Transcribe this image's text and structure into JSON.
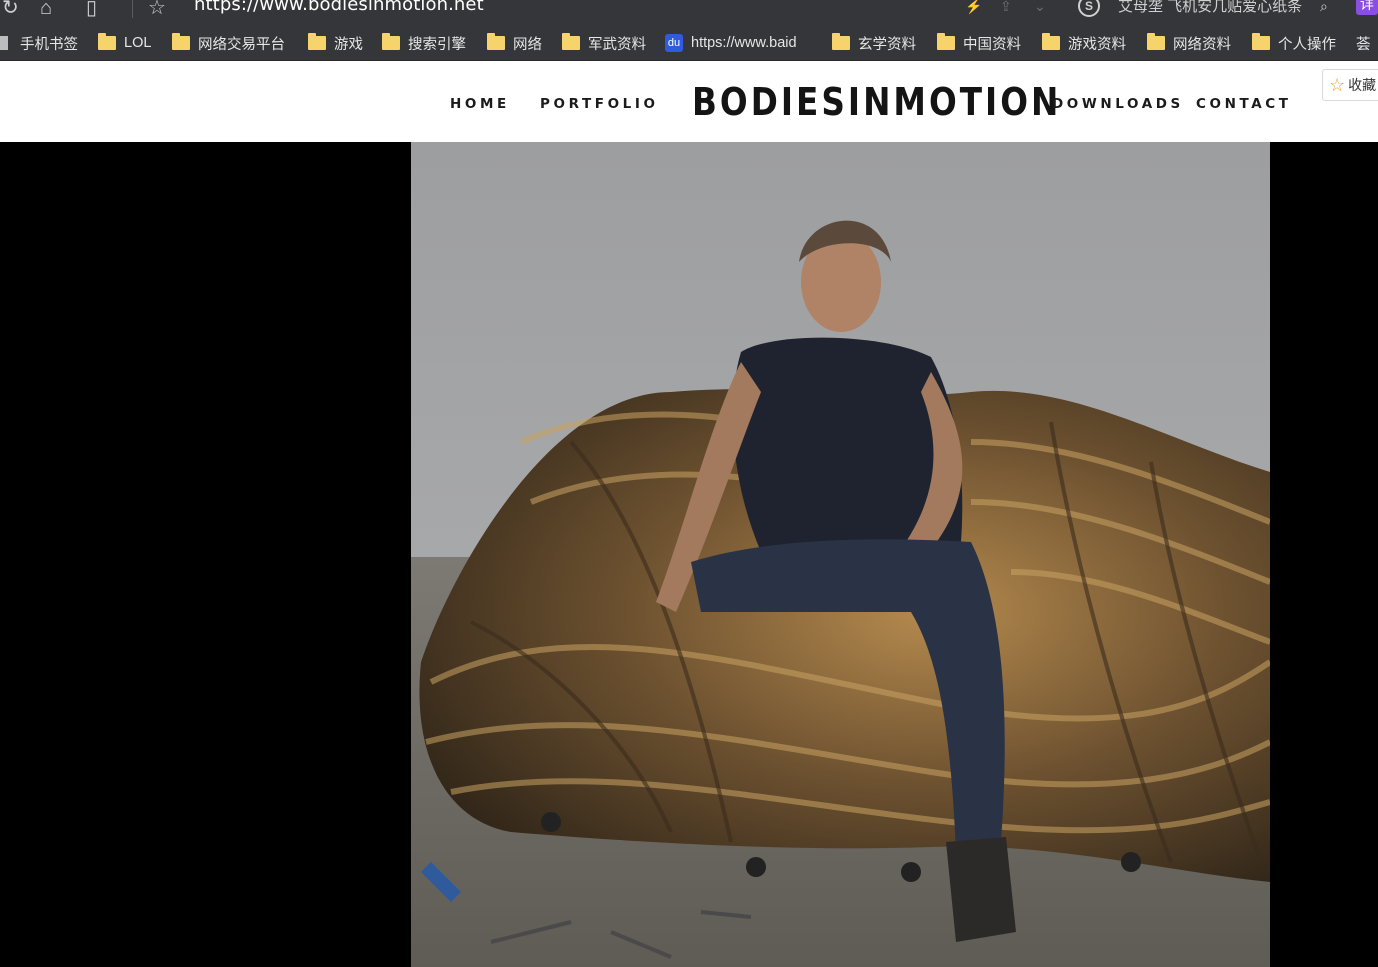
{
  "browser": {
    "url": "https://www.bodiesinmotion.net",
    "search_text": "艾母垄 飞机安几贴爱心纸条",
    "extension_label": "详"
  },
  "bookmarks": [
    {
      "label": "手机书签",
      "icon": "device-icon"
    },
    {
      "label": "LOL",
      "icon": "folder-icon"
    },
    {
      "label": "网络交易平台",
      "icon": "folder-icon"
    },
    {
      "label": "游戏",
      "icon": "folder-icon"
    },
    {
      "label": "搜索引擎",
      "icon": "folder-icon"
    },
    {
      "label": "网络",
      "icon": "folder-icon"
    },
    {
      "label": "军武资料",
      "icon": "folder-icon"
    },
    {
      "label": "https://www.baid",
      "icon": "baidu-icon"
    },
    {
      "label": "玄学资料",
      "icon": "folder-icon"
    },
    {
      "label": "中国资料",
      "icon": "folder-icon"
    },
    {
      "label": "游戏资料",
      "icon": "folder-icon"
    },
    {
      "label": "网络资料",
      "icon": "folder-icon"
    },
    {
      "label": "个人操作",
      "icon": "folder-icon"
    },
    {
      "label": "荟",
      "icon": ""
    }
  ],
  "site": {
    "logo": "BODIESINMOTION",
    "nav": {
      "home": "HOME",
      "portfolio": "PORTFOLIO",
      "downloads": "DOWNLOADS",
      "contact": "CONTACT"
    },
    "favorite_label": "收藏"
  },
  "colors": {
    "nav_bg": "#ffffff",
    "page_bg": "#000000",
    "chrome_bg": "#35363a",
    "folder": "#f6d46b"
  }
}
